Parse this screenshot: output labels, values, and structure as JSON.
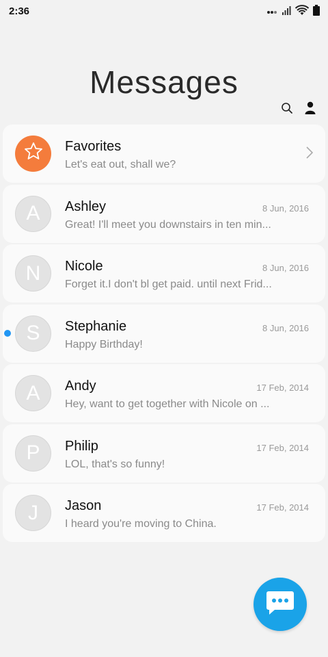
{
  "status_bar": {
    "time": "2:36"
  },
  "header": {
    "title": "Messages"
  },
  "toolbar": {
    "search_icon": "search-icon",
    "contacts_icon": "person-icon"
  },
  "favorites": {
    "title": "Favorites",
    "preview": "Let's eat out, shall we?",
    "icon": "star-icon",
    "color": "#f47c3c"
  },
  "conversations": [
    {
      "initial": "A",
      "name": "Ashley",
      "date": "8 Jun, 2016",
      "preview": "Great! I'll meet you downstairs in ten min...",
      "unread": false
    },
    {
      "initial": "N",
      "name": "Nicole",
      "date": "8 Jun, 2016",
      "preview": "Forget it.I don't bl get paid. until next Frid...",
      "unread": false
    },
    {
      "initial": "S",
      "name": "Stephanie",
      "date": "8 Jun, 2016",
      "preview": "Happy Birthday!",
      "unread": true
    },
    {
      "initial": "A",
      "name": "Andy",
      "date": "17 Feb, 2014",
      "preview": "Hey, want to get together with Nicole on ...",
      "unread": false
    },
    {
      "initial": "P",
      "name": "Philip",
      "date": "17 Feb, 2014",
      "preview": "LOL, that's so funny!",
      "unread": false
    },
    {
      "initial": "J",
      "name": "Jason",
      "date": "17 Feb, 2014",
      "preview": "I heard you're moving to China.",
      "unread": false
    }
  ],
  "fab": {
    "icon": "compose-message-icon",
    "color": "#1aa3e8"
  },
  "colors": {
    "unread_dot": "#2196f3",
    "avatar_bg": "#e3e3e3"
  }
}
